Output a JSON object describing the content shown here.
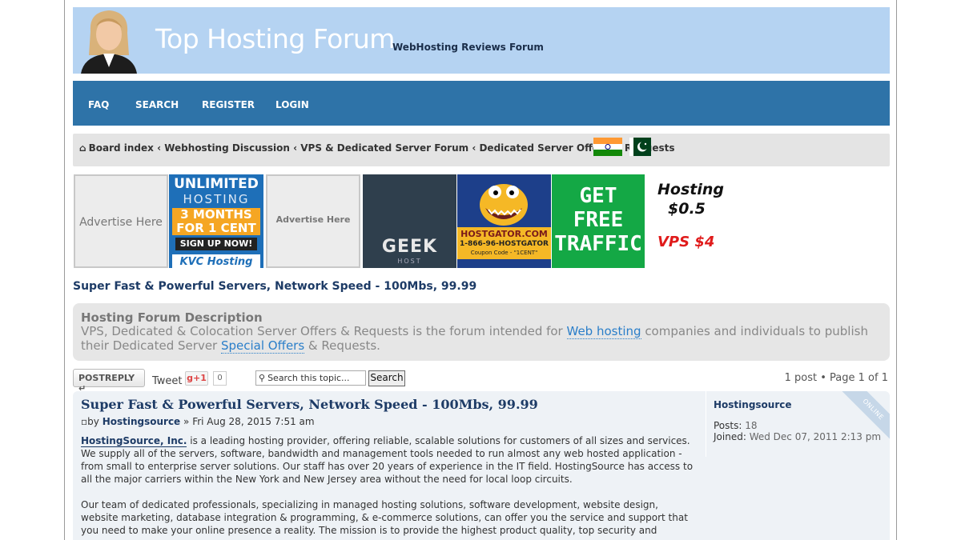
{
  "header": {
    "title": "Top Hosting Forum",
    "tagline": "WebHosting Reviews Forum"
  },
  "nav": [
    "FAQ",
    "SEARCH",
    "REGISTER",
    "LOGIN"
  ],
  "breadcrumbs": [
    "Board index",
    "Webhosting Discussion",
    "VPS & Dedicated Server Forum",
    "Dedicated Server Offers & Requests"
  ],
  "breadcrumb_separator": "‹",
  "flags": [
    "india-flag",
    "pakistan-flag"
  ],
  "ads": {
    "advertise_1": "Advertise Here",
    "unlimited": {
      "line1": "UNLIMITED",
      "line2": "HOSTING",
      "line3": "3 MONTHS",
      "line4": "FOR 1 CENT",
      "cta": "SIGN UP NOW!",
      "brand": "KVC Hosting"
    },
    "advertise_2": "Advertise Here",
    "geek": "GEEK",
    "geek_sub": "HOST",
    "hostgator": {
      "name": "HOSTGATOR.COM",
      "phone": "1-866-96-HOSTGATOR",
      "coupon": "Coupon Code - \"1CENT\""
    },
    "traffic": {
      "line1": "GET",
      "line2": "FREE",
      "line3": "TRAFFIC"
    },
    "cheap": {
      "line1": "Hosting",
      "line2": "$0.5",
      "line3": "VPS $4"
    }
  },
  "topic_heading": "Super Fast & Powerful Servers, Network Speed - 100Mbs, 99.99",
  "description": {
    "title": "Hosting Forum Description",
    "part1": "VPS, Dedicated & Colocation Server Offers & Requests is the forum intended for ",
    "link1": "Web hosting",
    "part2": " companies and individuals to publish their Dedicated Server ",
    "link2": "Special Offers",
    "part3": " & Requests."
  },
  "actions": {
    "postreply": "POSTREPLY",
    "tweet": "Tweet",
    "gplus": "g+1",
    "gplus_count": "0",
    "search_placeholder": "Search this topic...",
    "search_button": "Search",
    "pagination": "1 post • Page 1 of 1"
  },
  "post": {
    "title": "Super Fast & Powerful Servers, Network Speed - 100Mbs, 99.99",
    "by": "by",
    "author": "Hostingsource",
    "date": "» Fri Aug 28, 2015 7:51 am",
    "company_link": "HostingSource, Inc.",
    "para1": " is a leading hosting provider, offering reliable, scalable solutions for customers of all sizes and services. We supply all of the servers, software, bandwidth and management tools needed to run almost any web hosted application - from small to enterprise server solutions. Our staff has over 20 years of experience in the IT field. HostingSource has access to all the major carriers within the New York and New Jersey area without the need for local loop circuits.",
    "para2": "Our team of dedicated professionals, specializing in managed hosting solutions, software development, website design, website marketing, database integration & programming, & e-commerce solutions, can offer you the service and support that you need to make your online presence a reality. The mission is to provide the highest product quality, top security and"
  },
  "profile": {
    "name": "Hostingsource",
    "posts_label": "Posts:",
    "posts": "18",
    "joined_label": "Joined:",
    "joined": "Wed Dec 07, 2011 2:13 pm",
    "status": "ONLINE"
  }
}
